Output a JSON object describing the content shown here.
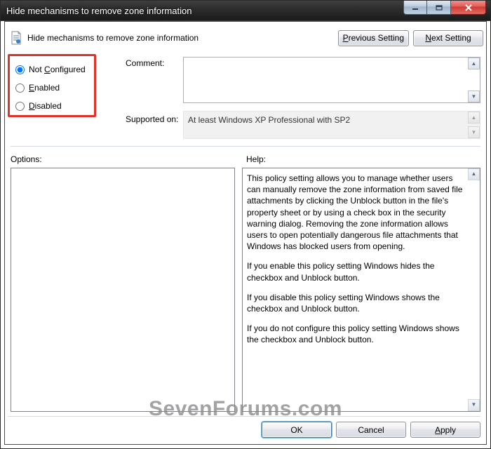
{
  "window": {
    "title": "Hide mechanisms to remove zone information"
  },
  "header": {
    "title": "Hide mechanisms to remove zone information",
    "prev_label_pre": "",
    "prev_ul": "P",
    "prev_label_post": "revious Setting",
    "next_label_pre": "",
    "next_ul": "N",
    "next_label_post": "ext Setting"
  },
  "state": {
    "options": [
      {
        "pre": "Not ",
        "ul": "C",
        "post": "onfigured",
        "selected": true
      },
      {
        "pre": "",
        "ul": "E",
        "post": "nabled",
        "selected": false
      },
      {
        "pre": "",
        "ul": "D",
        "post": "isabled",
        "selected": false
      }
    ]
  },
  "labels": {
    "comment": "Comment:",
    "supported": "Supported on:",
    "options": "Options:",
    "help": "Help:"
  },
  "comment": {
    "value": ""
  },
  "supported_on": "At least Windows XP Professional with SP2",
  "help": {
    "p1": "This policy setting allows you to manage whether users can manually remove the zone information from saved file attachments by clicking the Unblock button in the file's property sheet or by using a check box in the security warning dialog. Removing the zone information allows users to open potentially dangerous file attachments that Windows has blocked users from opening.",
    "p2": "If you enable this policy setting Windows hides the checkbox and Unblock button.",
    "p3": "If you disable this policy setting Windows shows the checkbox and Unblock button.",
    "p4": "If you do not configure this policy setting Windows shows the checkbox and Unblock button."
  },
  "buttons": {
    "ok": "OK",
    "cancel": "Cancel",
    "apply_ul": "A",
    "apply_post": "pply"
  },
  "watermark": "SevenForums.com"
}
